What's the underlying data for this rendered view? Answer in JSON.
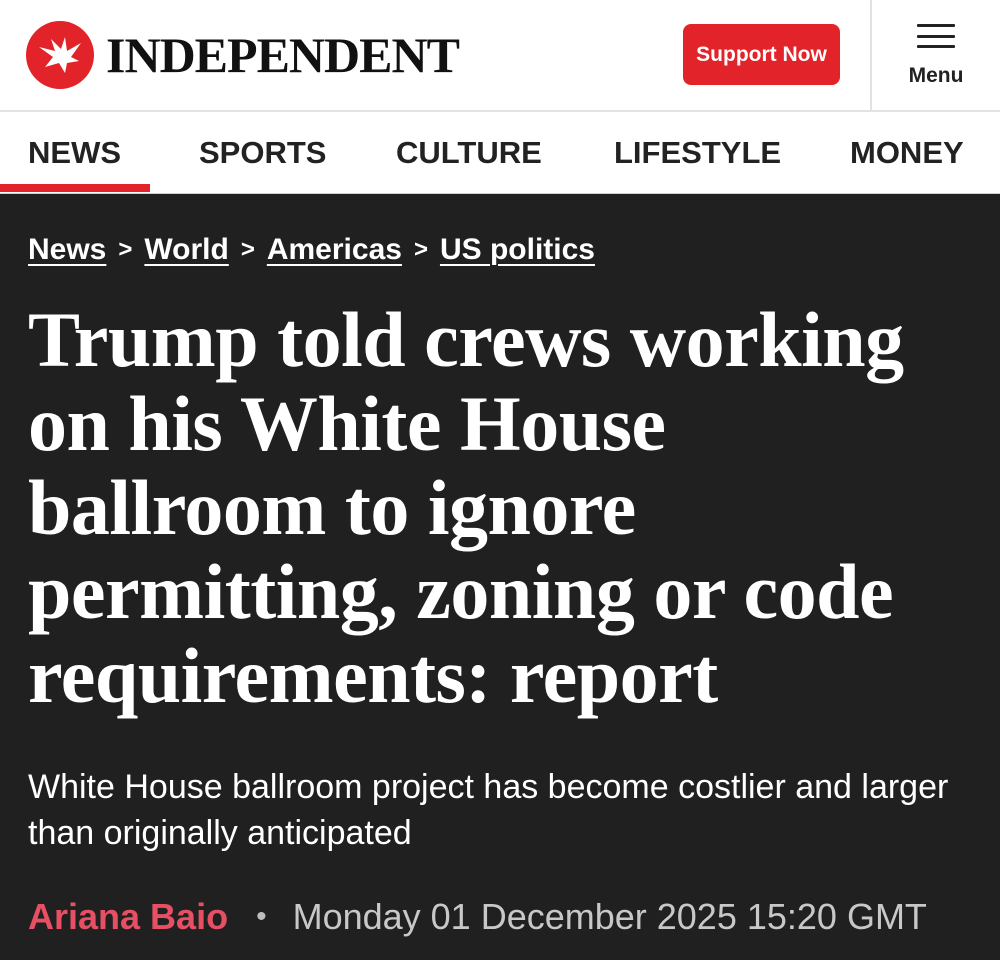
{
  "header": {
    "logo_text": "INDEPENDENT",
    "support_label": "Support Now",
    "menu_label": "Menu",
    "brand_color": "#e2232a"
  },
  "nav": {
    "items": [
      {
        "label": "NEWS",
        "active": true
      },
      {
        "label": "SPORTS"
      },
      {
        "label": "CULTURE"
      },
      {
        "label": "LIFESTYLE"
      },
      {
        "label": "MONEY"
      }
    ]
  },
  "breadcrumb": [
    "News",
    "World",
    "Americas",
    "US politics"
  ],
  "breadcrumb_separator": ">",
  "article": {
    "headline": "Trump told crews working on his White House ballroom to ignore permitting, zoning or code requirements: report",
    "standfirst": "White House ballroom project has become costlier and larger than originally anticipated",
    "author": "Ariana Baio",
    "separator": "•",
    "date": "Monday 01 December 2025 15:20 GMT"
  }
}
